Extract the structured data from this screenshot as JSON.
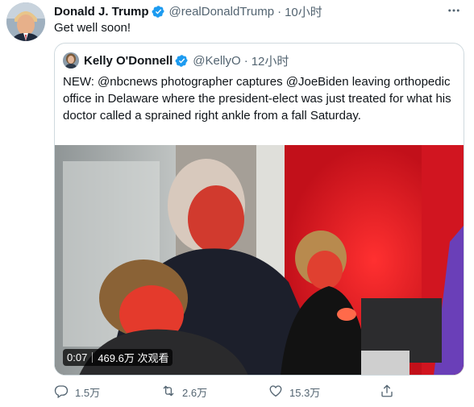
{
  "tweet": {
    "author_name": "Donald J. Trump",
    "author_handle": "@realDonaldTrump",
    "separator": "·",
    "time": "10小时",
    "text": "Get well soon!"
  },
  "quoted": {
    "author_name": "Kelly O'Donnell",
    "author_handle": "@KellyO",
    "separator": "·",
    "time": "12小时",
    "text": "NEW:  @nbcnews photographer captures @JoeBiden leaving orthopedic office in Delaware where the president-elect was just treated for what his doctor called a sprained right ankle from a fall Saturday.",
    "video": {
      "duration": "0:07",
      "views": "469.6万 次观看"
    }
  },
  "actions": {
    "replies": "1.5万",
    "retweets": "2.6万",
    "likes": "15.3万"
  },
  "colors": {
    "verified": "#1d9bf0",
    "muted": "#536471",
    "border": "#cfd9de"
  },
  "icons": [
    "more-icon",
    "verified-icon",
    "reply-icon",
    "retweet-icon",
    "like-icon",
    "share-icon"
  ]
}
